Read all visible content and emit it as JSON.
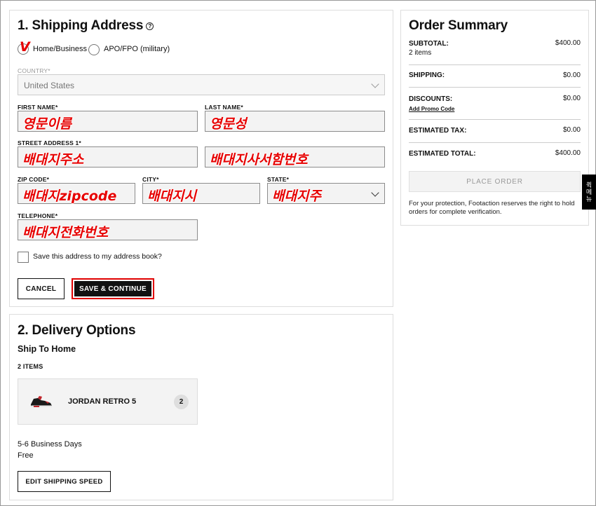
{
  "shipping": {
    "title": "1. Shipping Address",
    "help_icon": "?",
    "radio_home_label": "Home/Business",
    "radio_apo_label": "APO/FPO (military)",
    "check_mark": "V",
    "country_label": "COUNTRY*",
    "country_value": "United States",
    "first_name_label": "FIRST NAME*",
    "first_name_value": "영문이름",
    "last_name_label": "LAST NAME*",
    "last_name_value": "영문성",
    "street_label": "STREET ADDRESS 1*",
    "street_value": "배대지주소",
    "street2_value": "배대지사서함번호",
    "zip_label": "ZIP CODE*",
    "zip_value": "배대지zipcode",
    "city_label": "CITY*",
    "city_value": "배대지시",
    "state_label": "STATE*",
    "state_value": "배대지주",
    "phone_label": "TELEPHONE*",
    "phone_value": "배대지전화번호",
    "save_address_label": "Save this address to my address book?",
    "cancel_label": "CANCEL",
    "save_continue_label": "SAVE & CONTINUE"
  },
  "delivery": {
    "title": "2. Delivery Options",
    "method": "Ship To Home",
    "items_count": "2 ITEMS",
    "product_name": "JORDAN RETRO 5",
    "product_qty": "2",
    "eta": "5-6 Business Days",
    "cost": "Free",
    "edit_label": "EDIT SHIPPING SPEED"
  },
  "summary": {
    "title": "Order Summary",
    "subtotal_label": "SUBTOTAL:",
    "subtotal_value": "$400.00",
    "items": "2 items",
    "shipping_label": "SHIPPING:",
    "shipping_value": "$0.00",
    "discounts_label": "DISCOUNTS:",
    "discounts_value": "$0.00",
    "promo_link": "Add Promo Code",
    "tax_label": "ESTIMATED TAX:",
    "tax_value": "$0.00",
    "total_label": "ESTIMATED TOTAL:",
    "total_value": "$400.00",
    "place_order_label": "PLACE ORDER",
    "protection_note": "For your protection, Footaction reserves the right to hold orders for complete verification."
  },
  "side_tab": {
    "label": "퀵메뉴"
  },
  "colors": {
    "annotation_red": "#e60000",
    "button_dark": "#111111",
    "highlight_border": "#e00000"
  }
}
